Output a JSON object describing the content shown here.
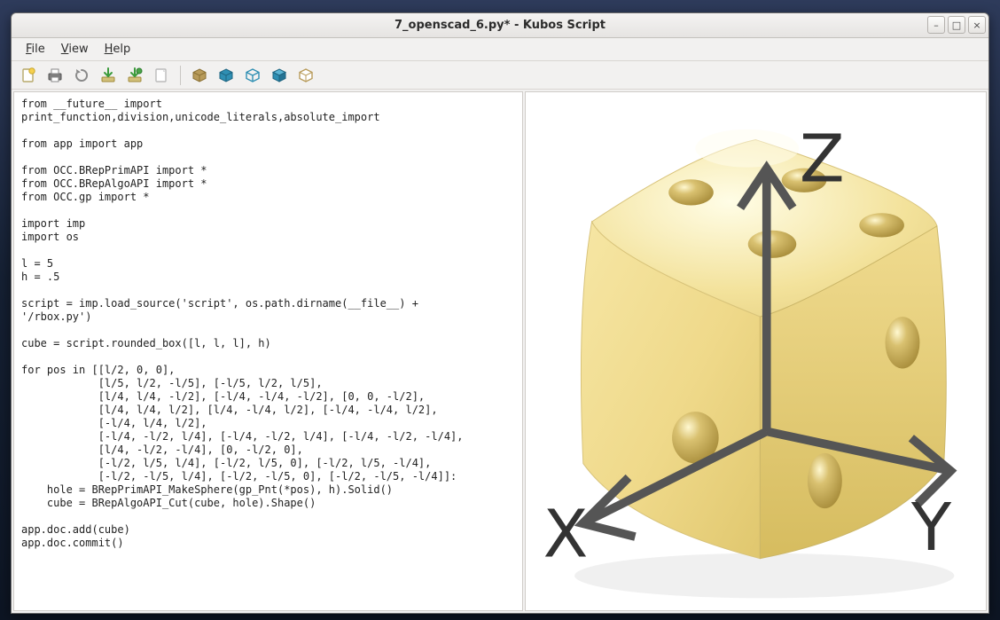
{
  "window": {
    "title": "7_openscad_6.py* - Kubos Script"
  },
  "win_controls": {
    "minimize": "–",
    "maximize": "□",
    "close": "×"
  },
  "menu": {
    "file": "File",
    "view": "View",
    "help": "Help"
  },
  "tool_icons": {
    "new": "new-file-icon",
    "print": "print-icon",
    "refresh": "refresh-icon",
    "download": "download-icon",
    "download2": "download-run-icon",
    "page": "page-icon",
    "cube_all": "cube-all-icon",
    "cube_solid": "cube-solid-icon",
    "cube_wire": "cube-wire-icon",
    "cube_shaded": "cube-shaded-icon",
    "cube_outline": "cube-outline-icon"
  },
  "axis": {
    "x": "X",
    "y": "Y",
    "z": "Z"
  },
  "code": "from __future__ import\nprint_function,division,unicode_literals,absolute_import\n\nfrom app import app\n\nfrom OCC.BRepPrimAPI import *\nfrom OCC.BRepAlgoAPI import *\nfrom OCC.gp import *\n\nimport imp\nimport os\n\nl = 5\nh = .5\n\nscript = imp.load_source('script', os.path.dirname(__file__) +\n'/rbox.py')\n\ncube = script.rounded_box([l, l, l], h)\n\nfor pos in [[l/2, 0, 0],\n            [l/5, l/2, -l/5], [-l/5, l/2, l/5],\n            [l/4, l/4, -l/2], [-l/4, -l/4, -l/2], [0, 0, -l/2],\n            [l/4, l/4, l/2], [l/4, -l/4, l/2], [-l/4, -l/4, l/2],\n            [-l/4, l/4, l/2],\n            [-l/4, -l/2, l/4], [-l/4, -l/2, l/4], [-l/4, -l/2, -l/4],\n            [l/4, -l/2, -l/4], [0, -l/2, 0],\n            [-l/2, l/5, l/4], [-l/2, l/5, 0], [-l/2, l/5, -l/4],\n            [-l/2, -l/5, l/4], [-l/2, -l/5, 0], [-l/2, -l/5, -l/4]]:\n    hole = BRepPrimAPI_MakeSphere(gp_Pnt(*pos), h).Solid()\n    cube = BRepAlgoAPI_Cut(cube, hole).Shape()\n\napp.doc.add(cube)\napp.doc.commit()"
}
